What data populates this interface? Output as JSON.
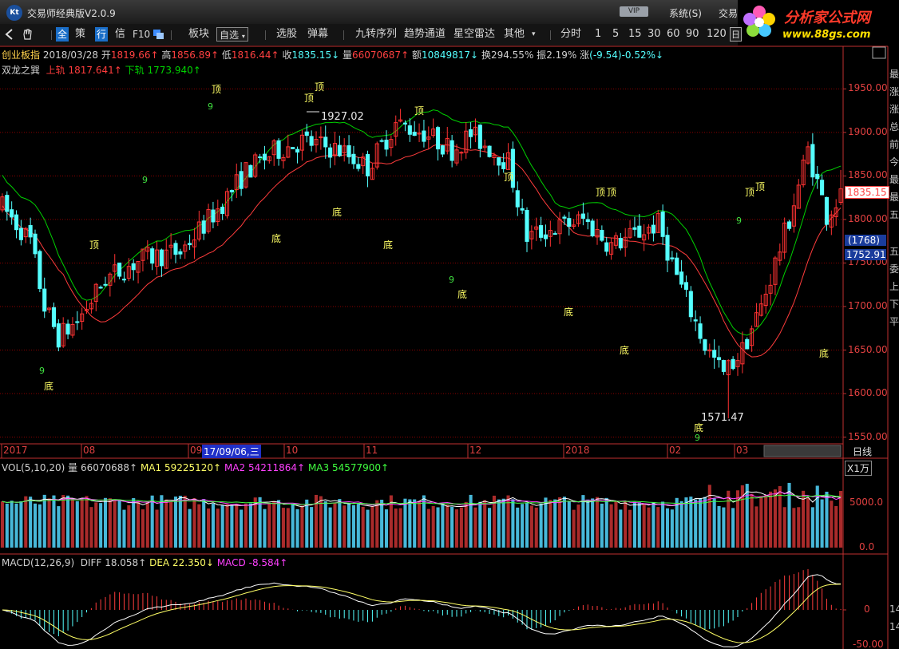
{
  "titlebar": {
    "title": "交易师经典版V2.0.9",
    "logo_text": "Kt",
    "vip": "VIP",
    "menus": [
      "系统(S)",
      "交易"
    ]
  },
  "banner": {
    "title": "分析家公式网",
    "url": "www.88gs.com"
  },
  "toolbar": {
    "nav_icons": [
      "back-arrow-icon",
      "hand-icon"
    ],
    "quick": [
      "全",
      "策",
      "行",
      "信",
      "F10"
    ],
    "sector": "板块",
    "watchlist": "自选",
    "items": [
      "选股",
      "弹幕",
      "九转序列",
      "趋势通道",
      "星空雷达",
      "其他"
    ],
    "periods": [
      "分时",
      "1",
      "5",
      "15",
      "30",
      "60",
      "90",
      "120"
    ],
    "boxed_period": "日"
  },
  "quote": {
    "name": "创业板指",
    "date": "2018/03/28",
    "open_label": "开",
    "open": "1819.66↑",
    "high_label": "高",
    "high": "1856.89↑",
    "low_label": "低",
    "low": "1816.44↑",
    "close_label": "收",
    "close": "1835.15↓",
    "vol_label": "量",
    "vol": "66070687↑",
    "amount_label": "额",
    "amount": "10849817↓",
    "turnover_label": "换",
    "turnover": "294.55%",
    "amplitude_label": "振",
    "amplitude": "2.19%",
    "change_label": "涨",
    "change": "(-9.54)-0.52%↓"
  },
  "indicator": {
    "name": "双龙之巽",
    "upper_label": "上轨",
    "upper": "1817.641↑",
    "lower_label": "下轨",
    "lower": "1773.940↑"
  },
  "price_axis": {
    "ticks": [
      "1950.00",
      "1900.00",
      "1850.00",
      "1800.00",
      "1750.00",
      "1700.00",
      "1650.00",
      "1600.00",
      "1550.00"
    ],
    "current_price": "1835.15",
    "cursor_label_1": "(1768)",
    "cursor_label_2": "1752.91"
  },
  "annotations": {
    "peak_label": "1927.02",
    "trough_label": "1571.47",
    "top_word": "顶",
    "bottom_word": "底",
    "nine": "9"
  },
  "date_axis": {
    "labels": [
      "2017",
      "08",
      "09",
      "10",
      "11",
      "12",
      "2018",
      "02",
      "03"
    ],
    "cursor_date": "17/09/06,三",
    "period_label": "日线"
  },
  "vol_panel": {
    "name": "VOL(5,10,20)",
    "vol_label": "量",
    "vol": "66070688↑",
    "ma1_label": "MA1",
    "ma1": "59225120↑",
    "ma2_label": "MA2",
    "ma2": "54211864↑",
    "ma3_label": "MA3",
    "ma3": "54577900↑",
    "unit": "X1万",
    "ticks": [
      "5000.0",
      "0.0"
    ]
  },
  "macd_panel": {
    "name": "MACD(12,26,9)",
    "diff_label": "DIFF",
    "diff": "18.058↑",
    "dea_label": "DEA",
    "dea": "22.350↓",
    "macd_label": "MACD",
    "macd": "-8.584↑",
    "ticks": [
      "0",
      "-50.00"
    ]
  },
  "right_panel": {
    "labels": [
      "最",
      "涨",
      "涨",
      "总",
      "前",
      "今",
      "最",
      "最",
      "五",
      "五",
      "委",
      "上",
      "下",
      "平",
      "14",
      "14"
    ]
  },
  "colors": {
    "up": "#ff3232",
    "down": "#54ffff",
    "upper_rail": "#00d000",
    "lower_rail": "#ff3c3c",
    "yellow": "#ffff66",
    "magenta": "#ff40ff",
    "grid": "#8b0000"
  }
}
